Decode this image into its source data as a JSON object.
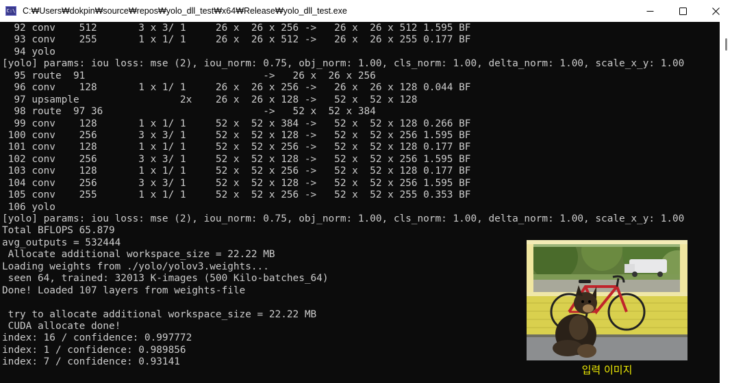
{
  "window": {
    "title": "C:₩Users₩dokpin₩source₩repos₩yolo_dll_test₩x64₩Release₩yolo_dll_test.exe",
    "icon_text": "C:\\"
  },
  "controls": {
    "minimize_icon": "minimize-icon",
    "maximize_icon": "maximize-icon",
    "close_icon": "close-icon"
  },
  "console": {
    "text_color": "#cccccc",
    "background": "#0c0c0c",
    "lines": [
      "  92 conv    512       3 x 3/ 1     26 x  26 x 256 ->   26 x  26 x 512 1.595 BF",
      "  93 conv    255       1 x 1/ 1     26 x  26 x 512 ->   26 x  26 x 255 0.177 BF",
      "  94 yolo",
      "[yolo] params: iou loss: mse (2), iou_norm: 0.75, obj_norm: 1.00, cls_norm: 1.00, delta_norm: 1.00, scale_x_y: 1.00",
      "  95 route  91                              ->   26 x  26 x 256",
      "  96 conv    128       1 x 1/ 1     26 x  26 x 256 ->   26 x  26 x 128 0.044 BF",
      "  97 upsample                 2x    26 x  26 x 128 ->   52 x  52 x 128",
      "  98 route  97 36                           ->   52 x  52 x 384",
      "  99 conv    128       1 x 1/ 1     52 x  52 x 384 ->   52 x  52 x 128 0.266 BF",
      " 100 conv    256       3 x 3/ 1     52 x  52 x 128 ->   52 x  52 x 256 1.595 BF",
      " 101 conv    128       1 x 1/ 1     52 x  52 x 256 ->   52 x  52 x 128 0.177 BF",
      " 102 conv    256       3 x 3/ 1     52 x  52 x 128 ->   52 x  52 x 256 1.595 BF",
      " 103 conv    128       1 x 1/ 1     52 x  52 x 256 ->   52 x  52 x 128 0.177 BF",
      " 104 conv    256       3 x 3/ 1     52 x  52 x 128 ->   52 x  52 x 256 1.595 BF",
      " 105 conv    255       1 x 1/ 1     52 x  52 x 256 ->   52 x  52 x 255 0.353 BF",
      " 106 yolo",
      "[yolo] params: iou loss: mse (2), iou_norm: 0.75, obj_norm: 1.00, cls_norm: 1.00, delta_norm: 1.00, scale_x_y: 1.00",
      "Total BFLOPS 65.879",
      "avg_outputs = 532444",
      " Allocate additional workspace_size = 22.22 MB",
      "Loading weights from ./yolo/yolov3.weights...",
      " seen 64, trained: 32013 K-images (500 Kilo-batches_64)",
      "Done! Loaded 107 layers from weights-file",
      "",
      " try to allocate additional workspace_size = 22.22 MB",
      " CUDA allocate done!",
      "index: 16 / confidence: 0.997772",
      "index: 1 / confidence: 0.989856",
      "index: 7 / confidence: 0.93141"
    ]
  },
  "overlay": {
    "image_name": "dog-bicycle-photo",
    "caption": "입력 이미지",
    "caption_color": "#f3f003"
  }
}
